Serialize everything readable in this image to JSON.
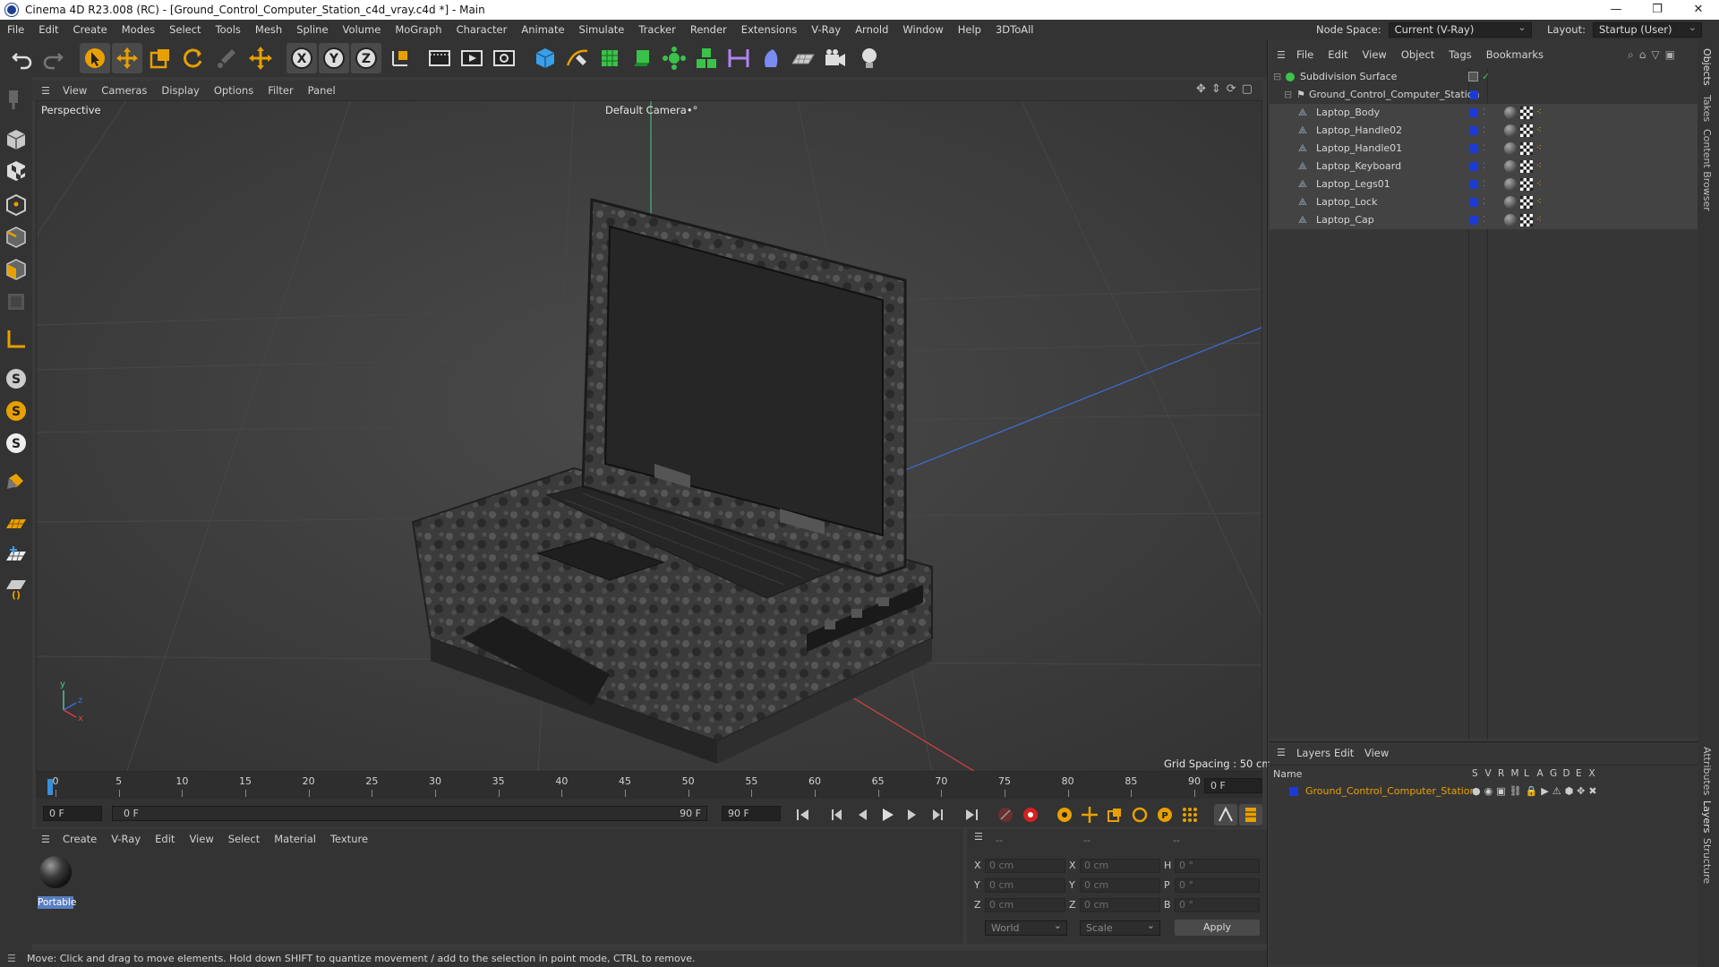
{
  "window": {
    "title": "Cinema 4D R23.008 (RC) - [Ground_Control_Computer_Station_c4d_vray.c4d *] - Main",
    "controls": [
      "—",
      "❐",
      "✕"
    ]
  },
  "menubar": {
    "items": [
      "File",
      "Edit",
      "Create",
      "Modes",
      "Select",
      "Tools",
      "Mesh",
      "Spline",
      "Volume",
      "MoGraph",
      "Character",
      "Animate",
      "Simulate",
      "Tracker",
      "Render",
      "Extensions",
      "V-Ray",
      "Arnold",
      "Window",
      "Help",
      "3DToAll"
    ],
    "node_space_label": "Node Space:",
    "node_space_value": "Current (V-Ray)",
    "layout_label": "Layout:",
    "layout_value": "Startup (User)"
  },
  "toolbar": {
    "icons": [
      "undo-icon",
      "redo-icon",
      "select-icon",
      "move-icon",
      "scale-icon",
      "rotate-icon",
      "brush-icon",
      "transform-icon",
      "x-axis-icon",
      "y-axis-icon",
      "z-axis-icon",
      "coordinate-system-icon",
      "render-region-icon",
      "render-view-icon",
      "render-settings-icon",
      "cube-icon",
      "pen-icon",
      "subdivision-icon",
      "extrude-icon",
      "cloner-icon",
      "cloner-alt-icon",
      "measure-icon",
      "deformer-icon",
      "floor-icon",
      "camera-icon",
      "light-icon"
    ],
    "axis_labels": [
      "X",
      "Y",
      "Z"
    ]
  },
  "viewport": {
    "menu": [
      "View",
      "Cameras",
      "Display",
      "Options",
      "Filter",
      "Panel"
    ],
    "projection": "Perspective",
    "camera": "Default Camera",
    "camera_suffix": "•°",
    "grid_spacing": "Grid Spacing : 50 cm",
    "axis_gizmo": {
      "y": "y",
      "z": "z",
      "x": "x"
    }
  },
  "timeline": {
    "ticks": [
      0,
      5,
      10,
      15,
      20,
      25,
      30,
      35,
      40,
      45,
      50,
      55,
      60,
      65,
      70,
      75,
      80,
      85,
      90
    ],
    "end_frame_field": "0 F",
    "current_frame": "0 F",
    "range_start": "0 F",
    "range_end": "90 F",
    "max_frame": "90 F"
  },
  "material_manager": {
    "menu": [
      "Create",
      "V-Ray",
      "Edit",
      "View",
      "Select",
      "Material",
      "Texture"
    ],
    "materials": [
      {
        "name": "Portable"
      }
    ]
  },
  "coordinates": {
    "headers": [
      "--",
      "--",
      "--"
    ],
    "rows": [
      {
        "a": "X",
        "a_val": "0 cm",
        "b": "X",
        "b_val": "0 cm",
        "c": "H",
        "c_val": "0 °"
      },
      {
        "a": "Y",
        "a_val": "0 cm",
        "b": "Y",
        "b_val": "0 cm",
        "c": "P",
        "c_val": "0 °"
      },
      {
        "a": "Z",
        "a_val": "0 cm",
        "b": "Z",
        "b_val": "0 cm",
        "c": "B",
        "c_val": "0 °"
      }
    ],
    "space": "World",
    "mode": "Scale",
    "apply": "Apply"
  },
  "status": "Move: Click and drag to move elements. Hold down SHIFT to quantize movement / add to the selection in point mode, CTRL to remove.",
  "object_manager": {
    "menu": [
      "File",
      "Edit",
      "View",
      "Object",
      "Tags",
      "Bookmarks"
    ],
    "objects": [
      {
        "name": "Subdivision Surface",
        "level": 0
      },
      {
        "name": "Ground_Control_Computer_Station",
        "level": 1
      },
      {
        "name": "Laptop_Body",
        "level": 2
      },
      {
        "name": "Laptop_Handle02",
        "level": 2
      },
      {
        "name": "Laptop_Handle01",
        "level": 2
      },
      {
        "name": "Laptop_Keyboard",
        "level": 2
      },
      {
        "name": "Laptop_Legs01",
        "level": 2
      },
      {
        "name": "Laptop_Lock",
        "level": 2
      },
      {
        "name": "Laptop_Cap",
        "level": 2
      }
    ]
  },
  "layer_manager": {
    "menu": [
      "Layers",
      "Edit",
      "View"
    ],
    "name_header": "Name",
    "columns": [
      "S",
      "V",
      "R",
      "M",
      "L",
      "A",
      "G",
      "D",
      "E",
      "X"
    ],
    "layers": [
      {
        "name": "Ground_Control_Computer_Station",
        "color": "#1b3bd8"
      }
    ]
  },
  "right_tabs": [
    "Objects",
    "Takes",
    "Content Browser",
    "Attributes",
    "Layers",
    "Structure"
  ],
  "colors": {
    "accent": "#e8a000",
    "layer_blue": "#1b3bd8",
    "selection": "#434343"
  }
}
